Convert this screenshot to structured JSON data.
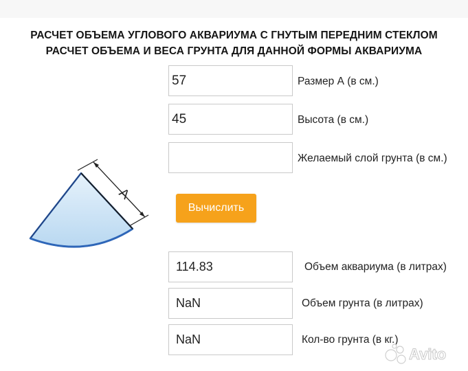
{
  "page": {
    "title_line1": "РАСЧЕТ ОБЪЕМА УГЛОВОГО АКВАРИУМА С ГНУТЫМ ПЕРЕДНИМ СТЕКЛОМ",
    "title_line2": "РАСЧЕТ ОБЪЕМА И ВЕСА ГРУНТА ДЛЯ ДАННОЙ ФОРМЫ АКВАРИУМА"
  },
  "inputs": {
    "size_a": {
      "value": "57",
      "label": "Размер А (в см.)"
    },
    "height": {
      "value": "45",
      "label": "Высота (в см.)"
    },
    "soil_layer": {
      "value": "",
      "label": "Желаемый слой грунта (в см.)"
    }
  },
  "button": {
    "label": "Вычислить",
    "color": "#f6a21b"
  },
  "results": {
    "volume": {
      "value": "114.83",
      "label": "Объем аквариума (в литрах)"
    },
    "soil_volume": {
      "value": "NaN",
      "label": "Объем грунта (в литрах)"
    },
    "soil_weight": {
      "value": "NaN",
      "label": "Кол-во грунта (в кг.)"
    }
  },
  "diagram": {
    "dimension_label": "A",
    "icon": "quarter-circle-aquarium-icon"
  },
  "watermark": {
    "text": "Avito",
    "icon": "avito-logo-icon"
  }
}
